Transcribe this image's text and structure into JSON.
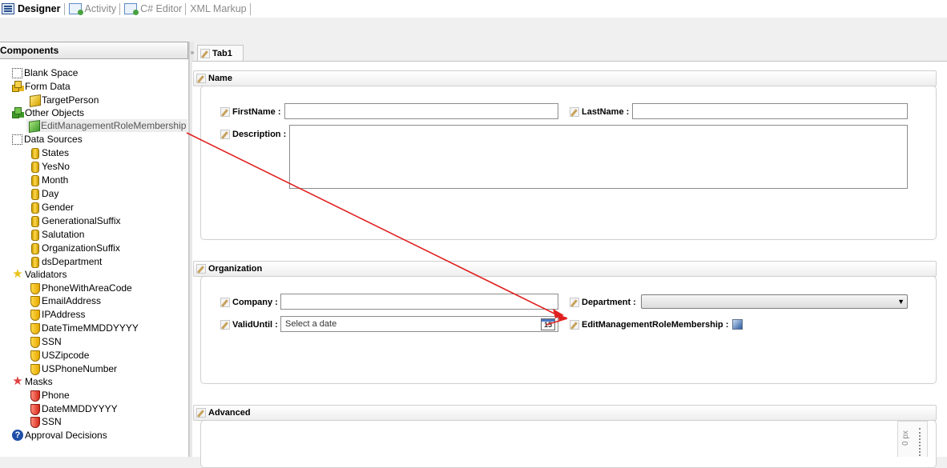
{
  "top_tabs": {
    "designer": "Designer",
    "activity": "Activity",
    "csharp": "C# Editor",
    "xml": "XML Markup"
  },
  "components_panel": {
    "title": "Components",
    "items": [
      {
        "label": "Blank Space",
        "icon": "blank-space-icon"
      },
      {
        "label": "Form Data",
        "icon": "form-data-icon"
      },
      {
        "label": "TargetPerson",
        "icon": "cube-icon"
      },
      {
        "label": "Other Objects",
        "icon": "other-objects-icon"
      },
      {
        "label": "EditManagementRoleMembership",
        "icon": "green-cube-icon"
      },
      {
        "label": "Data Sources",
        "icon": "blank-space-icon"
      },
      {
        "label": "States",
        "icon": "database-icon"
      },
      {
        "label": "YesNo",
        "icon": "database-icon"
      },
      {
        "label": "Month",
        "icon": "database-icon"
      },
      {
        "label": "Day",
        "icon": "database-icon"
      },
      {
        "label": "Gender",
        "icon": "database-icon"
      },
      {
        "label": "GenerationalSuffix",
        "icon": "database-icon"
      },
      {
        "label": "Salutation",
        "icon": "database-icon"
      },
      {
        "label": "OrganizationSuffix",
        "icon": "database-icon"
      },
      {
        "label": "dsDepartment",
        "icon": "database-icon"
      },
      {
        "label": "Validators",
        "icon": "star-icon"
      },
      {
        "label": "PhoneWithAreaCode",
        "icon": "shield-icon"
      },
      {
        "label": "EmailAddress",
        "icon": "shield-icon"
      },
      {
        "label": "IPAddress",
        "icon": "shield-icon"
      },
      {
        "label": "DateTimeMMDDYYYY",
        "icon": "shield-icon"
      },
      {
        "label": "SSN",
        "icon": "shield-icon"
      },
      {
        "label": "USZipcode",
        "icon": "shield-icon"
      },
      {
        "label": "USPhoneNumber",
        "icon": "shield-icon"
      },
      {
        "label": "Masks",
        "icon": "red-star-icon"
      },
      {
        "label": "Phone",
        "icon": "red-shield-icon"
      },
      {
        "label": "DateMMDDYYYY",
        "icon": "red-shield-icon"
      },
      {
        "label": "SSN",
        "icon": "red-shield-icon"
      },
      {
        "label": "Approval Decisions",
        "icon": "help-icon"
      }
    ]
  },
  "document_tab": "Tab1",
  "sections": {
    "name": {
      "title": "Name",
      "firstname_label": "FirstName :",
      "lastname_label": "LastName :",
      "description_label": "Description :"
    },
    "organization": {
      "title": "Organization",
      "company_label": "Company :",
      "department_label": "Department :",
      "validuntil_label": "ValidUntil :",
      "date_placeholder": "Select a date",
      "calendar_day": "15",
      "emrm_label": "EditManagementRoleMembership :"
    },
    "advanced": {
      "title": "Advanced"
    }
  },
  "ruler_text": "0 px",
  "colors": {
    "arrow": "#e02020",
    "selected_bg": "#ececec"
  }
}
